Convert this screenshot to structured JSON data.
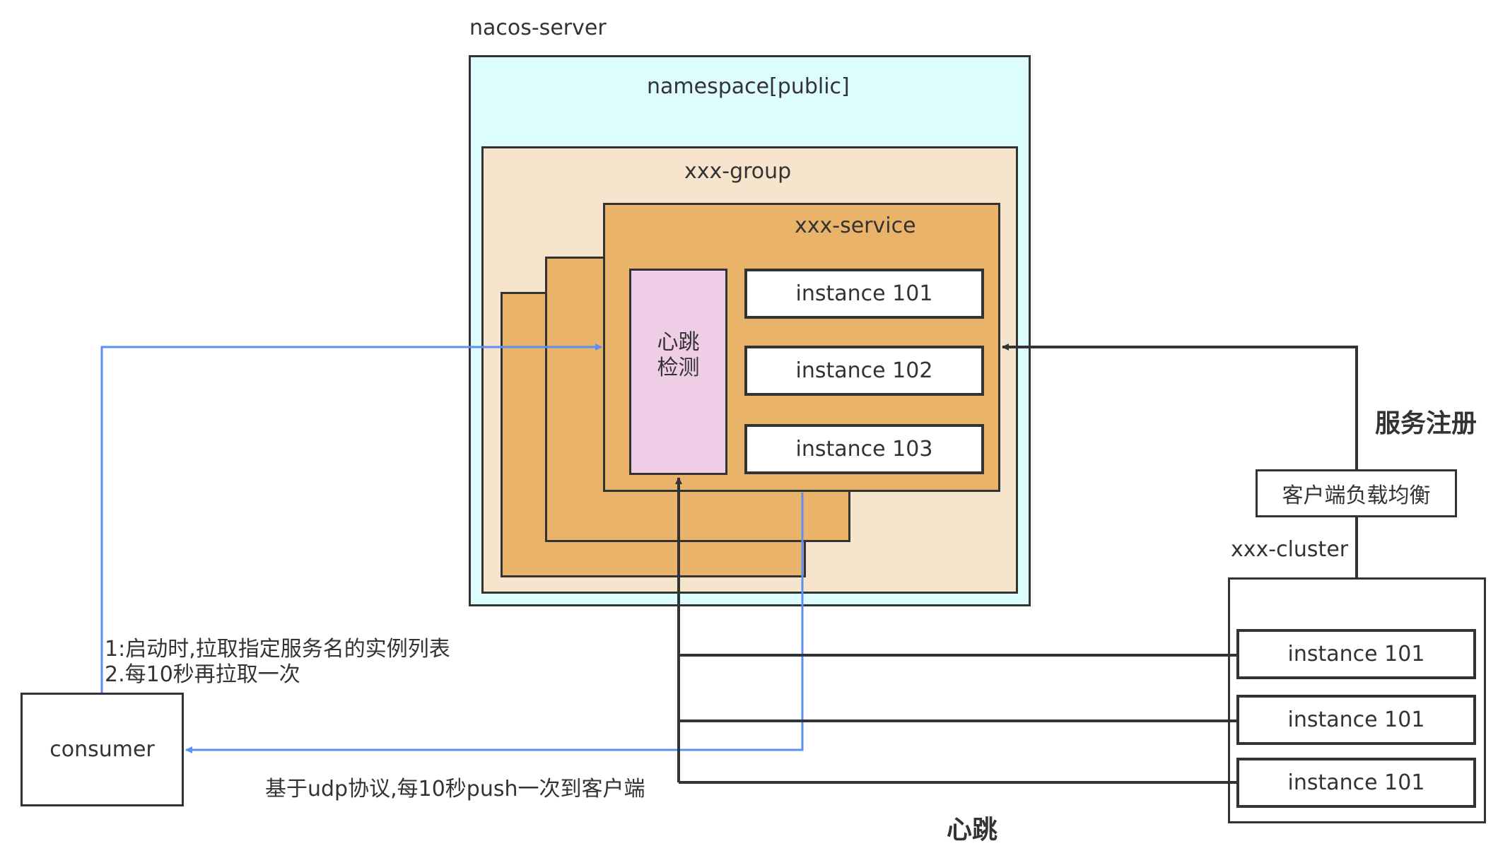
{
  "server": {
    "title": "nacos-server",
    "namespace": "namespace[public]",
    "group": "xxx-group",
    "service": "xxx-service",
    "heartbeat_check": [
      "心跳",
      "检测"
    ],
    "instances": [
      "instance 101",
      "instance 102",
      "instance 103"
    ]
  },
  "cluster": {
    "title": "xxx-cluster",
    "load_balance": "客户端负载均衡",
    "instances": [
      "instance 101",
      "instance 101",
      "instance 101"
    ]
  },
  "consumer": {
    "label": "consumer"
  },
  "annotations": {
    "pull_line1": "1:启动时,拉取指定服务名的实例列表",
    "pull_line2": "2.每10秒再拉取一次",
    "push": "基于udp协议,每10秒push一次到客户端",
    "register": "服务注册",
    "heartbeat": "心跳"
  },
  "colors": {
    "namespace_fill": "#dcfcfd",
    "group_fill": "#f6e4cc",
    "service_fill": "#e9b469",
    "heartbeat_fill": "#f0cde6",
    "blue_arrow": "#5b8ff2",
    "dark_line": "#333333"
  }
}
